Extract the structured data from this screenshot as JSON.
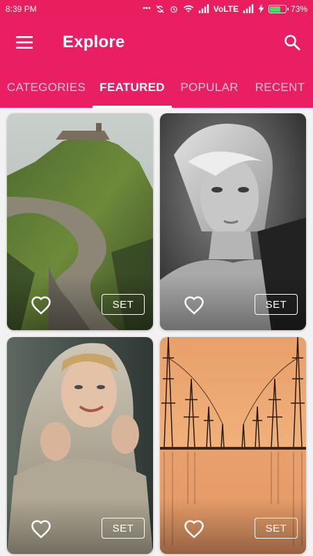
{
  "status_bar": {
    "time": "8:39 PM",
    "icons": [
      "notification-dots-icon",
      "sync-off-icon",
      "alarm-icon",
      "wifi-icon",
      "signal-icon",
      "volte-label",
      "signal-icon",
      "charging-icon",
      "battery-icon"
    ],
    "network": "VoLTE",
    "battery_percent": "73%",
    "battery_level": 0.73
  },
  "app_bar": {
    "title": "Explore",
    "menu_icon": "hamburger-menu-icon",
    "search_icon": "search-icon",
    "color": "#e91e63"
  },
  "tabs": [
    {
      "label": "CATEGORIES",
      "active": false
    },
    {
      "label": "FEATURED",
      "active": true
    },
    {
      "label": "POPULAR",
      "active": false
    },
    {
      "label": "RECENT",
      "active": false
    }
  ],
  "wallpapers": [
    {
      "subject": "coastal-stone-path",
      "favorite_icon": "heart-outline-icon",
      "set_label": "SET"
    },
    {
      "subject": "woman-portrait-bw",
      "favorite_icon": "heart-outline-icon",
      "set_label": "SET"
    },
    {
      "subject": "woman-scarf-portrait",
      "favorite_icon": "heart-outline-icon",
      "set_label": "SET"
    },
    {
      "subject": "power-lines-sunset",
      "favorite_icon": "heart-outline-icon",
      "set_label": "SET"
    }
  ]
}
